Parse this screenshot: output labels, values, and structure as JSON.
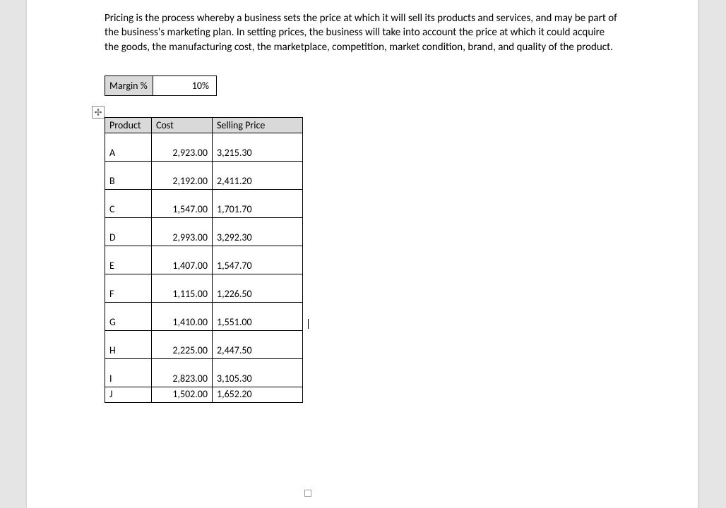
{
  "paragraph": "Pricing is the process whereby a business sets the price at which it will sell its products and services, and may be part of the business's marketing plan. In setting prices, the business will take into account the price at which it could acquire the goods, the manufacturing cost, the marketplace, competition, market condition, brand, and quality of the product.",
  "margin": {
    "label": "Margin %",
    "value": "10%"
  },
  "headers": {
    "product": "Product",
    "cost": "Cost",
    "price": "Selling Price"
  },
  "rows": [
    {
      "product": "A",
      "cost": "2,923.00",
      "price": "3,215.30"
    },
    {
      "product": "B",
      "cost": "2,192.00",
      "price": "2,411.20"
    },
    {
      "product": "C",
      "cost": "1,547.00",
      "price": "1,701.70"
    },
    {
      "product": "D",
      "cost": "2,993.00",
      "price": "3,292.30"
    },
    {
      "product": "E",
      "cost": "1,407.00",
      "price": "1,547.70"
    },
    {
      "product": "F",
      "cost": "1,115.00",
      "price": "1,226.50"
    },
    {
      "product": "G",
      "cost": "1,410.00",
      "price": "1,551.00"
    },
    {
      "product": "H",
      "cost": "2,225.00",
      "price": "2,447.50"
    },
    {
      "product": "I",
      "cost": "2,823.00",
      "price": "3,105.30"
    },
    {
      "product": "J",
      "cost": "1,502.00",
      "price": "1,652.20"
    }
  ]
}
